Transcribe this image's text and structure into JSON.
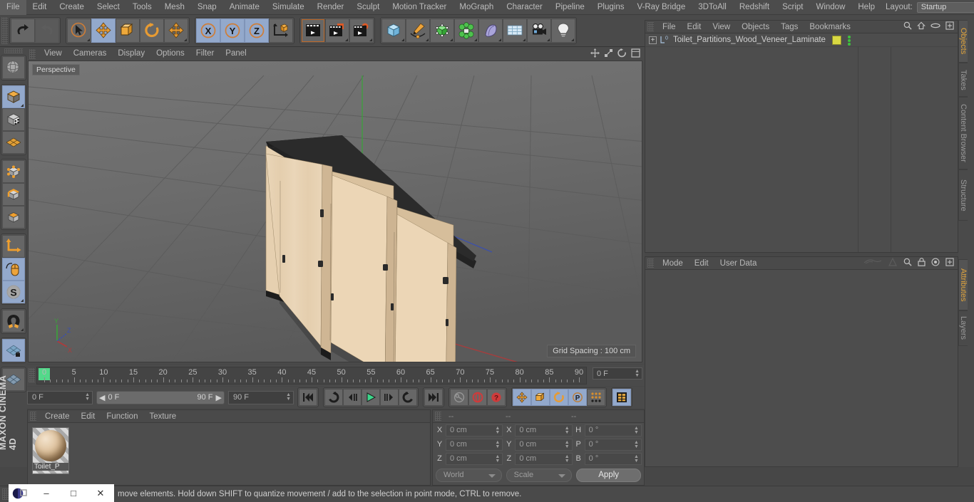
{
  "app": {
    "brand": "MAXON CINEMA 4D"
  },
  "menubar": {
    "items": [
      "File",
      "Edit",
      "Create",
      "Select",
      "Tools",
      "Mesh",
      "Snap",
      "Animate",
      "Simulate",
      "Render",
      "Sculpt",
      "Motion Tracker",
      "MoGraph",
      "Character",
      "Pipeline",
      "Plugins",
      "V-Ray Bridge",
      "3DToAll",
      "Redshift",
      "Script",
      "Window",
      "Help"
    ],
    "layout_label": "Layout:",
    "layout_value": "Startup"
  },
  "toolbar": {
    "groups": [
      {
        "name": "history",
        "buttons": [
          {
            "name": "undo-button",
            "icon": "undo-icon",
            "state": "normal"
          },
          {
            "name": "redo-button",
            "icon": "redo-icon",
            "state": "disabled"
          }
        ]
      },
      {
        "name": "transform",
        "buttons": [
          {
            "name": "live-selection-button",
            "icon": "cursor-select-icon",
            "state": "normal"
          },
          {
            "name": "move-button",
            "icon": "move-arrows-icon",
            "state": "selected"
          },
          {
            "name": "scale-button",
            "icon": "scale-box-icon",
            "state": "normal"
          },
          {
            "name": "rotate-button",
            "icon": "rotate-circle-icon",
            "state": "normal"
          },
          {
            "name": "move-alt-button",
            "icon": "move-arrows-icon",
            "state": "normal"
          }
        ]
      },
      {
        "name": "axis-lock",
        "buttons": [
          {
            "name": "lock-x-button",
            "icon": "x-axis-icon",
            "state": "selected"
          },
          {
            "name": "lock-y-button",
            "icon": "y-axis-icon",
            "state": "selected"
          },
          {
            "name": "lock-z-button",
            "icon": "z-axis-icon",
            "state": "selected"
          },
          {
            "name": "world-coordinates-button",
            "icon": "world-axis-cube-icon",
            "state": "normal"
          }
        ]
      },
      {
        "name": "render",
        "buttons": [
          {
            "name": "render-view-button",
            "icon": "clapper-view-icon",
            "state": "normal"
          },
          {
            "name": "render-region-button",
            "icon": "clapper-region-icon",
            "state": "normal"
          },
          {
            "name": "render-settings-button",
            "icon": "clapper-gear-icon",
            "state": "normal"
          }
        ]
      },
      {
        "name": "create",
        "buttons": [
          {
            "name": "cube-primitive-button",
            "icon": "blue-cube-icon",
            "state": "normal"
          },
          {
            "name": "spline-pen-button",
            "icon": "pen-spline-icon",
            "state": "normal"
          },
          {
            "name": "generator-button",
            "icon": "green-cube-icon",
            "state": "normal"
          },
          {
            "name": "mograph-button",
            "icon": "green-cluster-icon",
            "state": "normal"
          },
          {
            "name": "deformer-button",
            "icon": "bend-deformer-icon",
            "state": "normal"
          },
          {
            "name": "scene-environment-button",
            "icon": "floor-grid-icon",
            "state": "normal"
          },
          {
            "name": "camera-button",
            "icon": "camera-icon",
            "state": "normal"
          },
          {
            "name": "light-button",
            "icon": "light-bulb-icon",
            "state": "normal"
          }
        ]
      }
    ]
  },
  "left_toolbar": {
    "groups": [
      [
        {
          "name": "undo-view-button",
          "icon": "globe-wire-icon",
          "state": "normal"
        }
      ],
      [
        {
          "name": "object-mode-button",
          "icon": "orange-cube-icon",
          "state": "selected"
        },
        {
          "name": "texture-mode-button",
          "icon": "checker-cube-icon",
          "state": "normal"
        },
        {
          "name": "workplane-button",
          "icon": "orange-grid-icon",
          "state": "normal"
        }
      ],
      [
        {
          "name": "points-mode-button",
          "icon": "points-cube-icon",
          "state": "normal"
        },
        {
          "name": "edges-mode-button",
          "icon": "edges-cube-icon",
          "state": "normal"
        },
        {
          "name": "polygons-mode-button",
          "icon": "polygons-cube-icon",
          "state": "normal"
        }
      ],
      [
        {
          "name": "object-axis-button",
          "icon": "axis-corner-icon",
          "state": "normal"
        },
        {
          "name": "enable-axis-modification-button",
          "icon": "mouse-axis-icon",
          "state": "selected"
        },
        {
          "name": "soft-selection-button",
          "icon": "soft-selection-s-icon",
          "state": "selected"
        }
      ],
      [
        {
          "name": "snap-button",
          "icon": "magnet-icon",
          "state": "normal"
        }
      ],
      [
        {
          "name": "workplane-lock-button",
          "icon": "grid-lock-icon",
          "state": "selected"
        }
      ],
      [
        {
          "name": "viewport-solo-button",
          "icon": "grid-shade-icon",
          "state": "normal"
        }
      ]
    ]
  },
  "viewport": {
    "menu": [
      "View",
      "Cameras",
      "Display",
      "Options",
      "Filter",
      "Panel"
    ],
    "label": "Perspective",
    "grid_spacing": "Grid Spacing : 100 cm",
    "axis_gizmo": {
      "x": "X",
      "y": "Y",
      "z": "Z"
    },
    "header_icons": [
      "move-view-icon",
      "scale-view-icon",
      "rotate-view-icon",
      "maximize-view-icon"
    ]
  },
  "object_manager": {
    "menu": [
      "File",
      "Edit",
      "View",
      "Objects",
      "Tags",
      "Bookmarks"
    ],
    "header_icons": [
      "search-icon",
      "home-icon",
      "ellipse-icon",
      "plus-box-icon"
    ],
    "tab_label": "Objects",
    "rows": [
      {
        "name": "Toilet_Partitions_Wood_Veneer_Laminate",
        "expander": "+",
        "level_badge": "0",
        "material_color": "#d8d842"
      }
    ]
  },
  "attributes": {
    "menu": [
      "Mode",
      "Edit",
      "User Data"
    ],
    "header_icons": [
      "wing-icon",
      "cone-icon",
      "search-icon",
      "lock-icon",
      "target-icon",
      "plus-box-icon"
    ],
    "tab_label": "Attributes"
  },
  "right_tabs": {
    "top": [
      "Objects",
      "Takes",
      "Content Browser",
      "Structure"
    ],
    "bottom": [
      "Attributes",
      "Layers"
    ],
    "active_top": "Objects",
    "active_bottom": "Attributes"
  },
  "timeline": {
    "ticks": [
      0,
      5,
      10,
      15,
      20,
      25,
      30,
      35,
      40,
      45,
      50,
      55,
      60,
      65,
      70,
      75,
      80,
      85,
      90
    ],
    "min": 0,
    "max": 90,
    "current_frame_field": "0 F",
    "playhead_frame": 0
  },
  "anim_bar": {
    "current_frame": "0 F",
    "range_start": "0 F",
    "range_end": "90 F",
    "end_frame": "90 F",
    "buttons": [
      {
        "name": "go-to-start-button",
        "icon": "skip-start-icon",
        "state": "normal"
      },
      {
        "name": "play-backwards-button",
        "icon": "rewind-loop-icon",
        "state": "normal"
      },
      {
        "name": "previous-frame-button",
        "icon": "step-back-icon",
        "state": "normal"
      },
      {
        "name": "play-button",
        "icon": "play-triangle-icon",
        "state": "normal"
      },
      {
        "name": "next-frame-button",
        "icon": "step-forward-icon",
        "state": "normal"
      },
      {
        "name": "play-forwards-button",
        "icon": "forward-loop-icon",
        "state": "normal"
      },
      {
        "name": "go-to-end-button",
        "icon": "skip-end-icon",
        "state": "normal"
      },
      {
        "name": "record-active-objects-button",
        "icon": "key-icon",
        "state": "disabled"
      },
      {
        "name": "autokeying-button",
        "icon": "red-circle-icon",
        "state": "normal"
      },
      {
        "name": "keyframe-selection-button",
        "icon": "red-question-icon",
        "state": "normal"
      },
      {
        "name": "position-key-button",
        "icon": "move-arrows-icon",
        "state": "selected"
      },
      {
        "name": "scale-key-button",
        "icon": "scale-box-icon",
        "state": "selected"
      },
      {
        "name": "rotation-key-button",
        "icon": "rotate-circle-icon",
        "state": "selected"
      },
      {
        "name": "parameter-key-button",
        "icon": "p-circle-icon",
        "state": "selected"
      },
      {
        "name": "point-level-animation-button",
        "icon": "dot-grid-icon",
        "state": "normal"
      },
      {
        "name": "timeline-view-button",
        "icon": "filmstrip-icon",
        "state": "selected"
      }
    ]
  },
  "material_manager": {
    "menu": [
      "Create",
      "Edit",
      "Function",
      "Texture"
    ],
    "materials": [
      {
        "name": "Toilet_P"
      }
    ]
  },
  "coordinates": {
    "title_dashes": [
      "--",
      "--",
      "--"
    ],
    "rows": [
      {
        "label_pos": "X",
        "value_pos": "0 cm",
        "label_size": "X",
        "value_size": "0 cm",
        "label_rot": "H",
        "value_rot": "0 °"
      },
      {
        "label_pos": "Y",
        "value_pos": "0 cm",
        "label_size": "Y",
        "value_size": "0 cm",
        "label_rot": "P",
        "value_rot": "0 °"
      },
      {
        "label_pos": "Z",
        "value_pos": "0 cm",
        "label_size": "Z",
        "value_size": "0 cm",
        "label_rot": "B",
        "value_rot": "0 °"
      }
    ],
    "system_value": "World",
    "mode_value": "Scale",
    "apply_label": "Apply"
  },
  "status_bar": {
    "text": "move elements. Hold down SHIFT to quantize movement / add to the selection in point mode, CTRL to remove."
  },
  "window_controls": {
    "minimize": "–",
    "maximize": "□",
    "close": "✕"
  },
  "colors": {
    "accent_orange": "#e0a43c",
    "selected_blue": "#93a9cc",
    "panel_bg": "#4d4d4d",
    "toolbar_bg": "#4a4a4a",
    "playhead_green": "#53d98a",
    "material_yellow": "#d8d842"
  }
}
